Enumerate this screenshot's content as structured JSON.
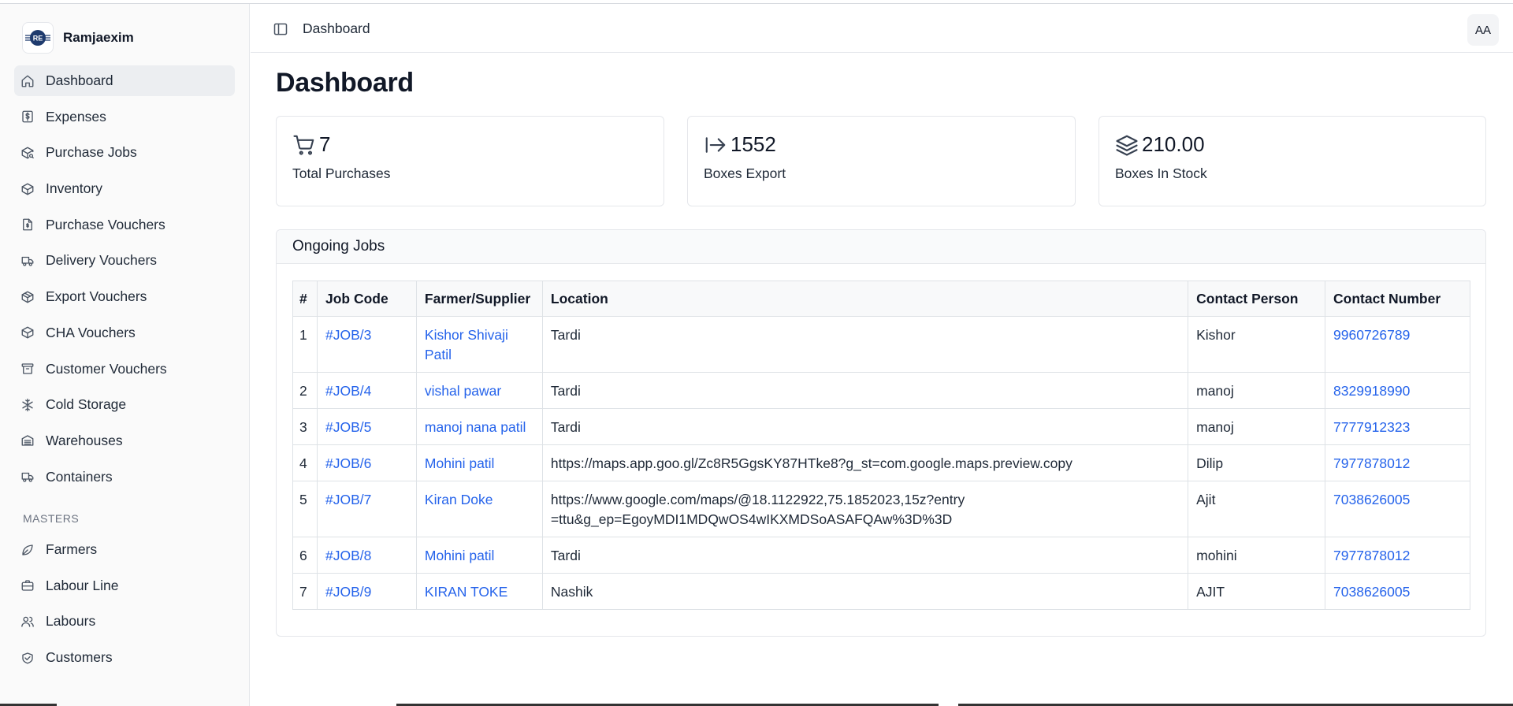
{
  "brand": {
    "name": "Ramjaexim",
    "logo_text": "RE"
  },
  "sidebar": {
    "items": [
      {
        "label": "Dashboard",
        "icon": "home-icon",
        "active": true
      },
      {
        "label": "Expenses",
        "icon": "dollar-receipt-icon"
      },
      {
        "label": "Purchase Jobs",
        "icon": "package-search-icon"
      },
      {
        "label": "Inventory",
        "icon": "box-icon"
      },
      {
        "label": "Purchase Vouchers",
        "icon": "file-dollar-icon"
      },
      {
        "label": "Delivery Vouchers",
        "icon": "truck-icon"
      },
      {
        "label": "Export Vouchers",
        "icon": "package-export-icon"
      },
      {
        "label": "CHA Vouchers",
        "icon": "box-icon"
      },
      {
        "label": "Customer Vouchers",
        "icon": "archive-icon"
      },
      {
        "label": "Cold Storage",
        "icon": "snowflake-icon"
      },
      {
        "label": "Warehouses",
        "icon": "warehouse-icon"
      },
      {
        "label": "Containers",
        "icon": "truck-icon"
      }
    ],
    "masters_label": "MASTERS",
    "masters": [
      {
        "label": "Farmers",
        "icon": "leaf-icon"
      },
      {
        "label": "Labour Line",
        "icon": "briefcase-icon"
      },
      {
        "label": "Labours",
        "icon": "users-icon"
      },
      {
        "label": "Customers",
        "icon": "handshake-icon"
      }
    ]
  },
  "header": {
    "title": "Dashboard",
    "avatar": "AA"
  },
  "main": {
    "title": "Dashboard",
    "stats": [
      {
        "value": "7",
        "label": "Total Purchases",
        "icon": "cart-icon"
      },
      {
        "value": "1552",
        "label": "Boxes Export",
        "icon": "arrow-right-to-line-icon"
      },
      {
        "value": "210.00",
        "label": "Boxes In Stock",
        "icon": "layers-icon"
      }
    ],
    "jobs": {
      "title": "Ongoing Jobs",
      "columns": [
        "#",
        "Job Code",
        "Farmer/Supplier",
        "Location",
        "Contact Person",
        "Contact Number"
      ],
      "rows": [
        {
          "n": "1",
          "code": "#JOB/3",
          "farmer": "Kishor Shivaji Patil",
          "location": "Tardi",
          "person": "Kishor",
          "phone": "9960726789"
        },
        {
          "n": "2",
          "code": "#JOB/4",
          "farmer": "vishal pawar",
          "location": "Tardi",
          "person": "manoj",
          "phone": "8329918990"
        },
        {
          "n": "3",
          "code": "#JOB/5",
          "farmer": "manoj nana patil",
          "location": "Tardi",
          "person": "manoj",
          "phone": "7777912323"
        },
        {
          "n": "4",
          "code": "#JOB/6",
          "farmer": "Mohini patil",
          "location": "https://maps.app.goo.gl/Zc8R5GgsKY87HTke8?g_st=com.google.maps.preview.copy",
          "person": "Dilip",
          "phone": "7977878012"
        },
        {
          "n": "5",
          "code": "#JOB/7",
          "farmer": "Kiran Doke",
          "location": "https://www.google.com/maps/@18.1122922,75.1852023,15z?entry=ttu&g_ep=EgoyMDI1MDQwOS4wIKXMDSoASAFQAw%3D%3D",
          "person": "Ajit",
          "phone": "7038626005"
        },
        {
          "n": "6",
          "code": "#JOB/8",
          "farmer": "Mohini patil",
          "location": "Tardi",
          "person": "mohini",
          "phone": "7977878012"
        },
        {
          "n": "7",
          "code": "#JOB/9",
          "farmer": "KIRAN TOKE",
          "location": "Nashik",
          "person": "AJIT",
          "phone": "7038626005"
        }
      ]
    }
  },
  "colors": {
    "link": "#2563eb",
    "active_bg": "#eceef1",
    "sidebar_bg": "#fafafa"
  }
}
